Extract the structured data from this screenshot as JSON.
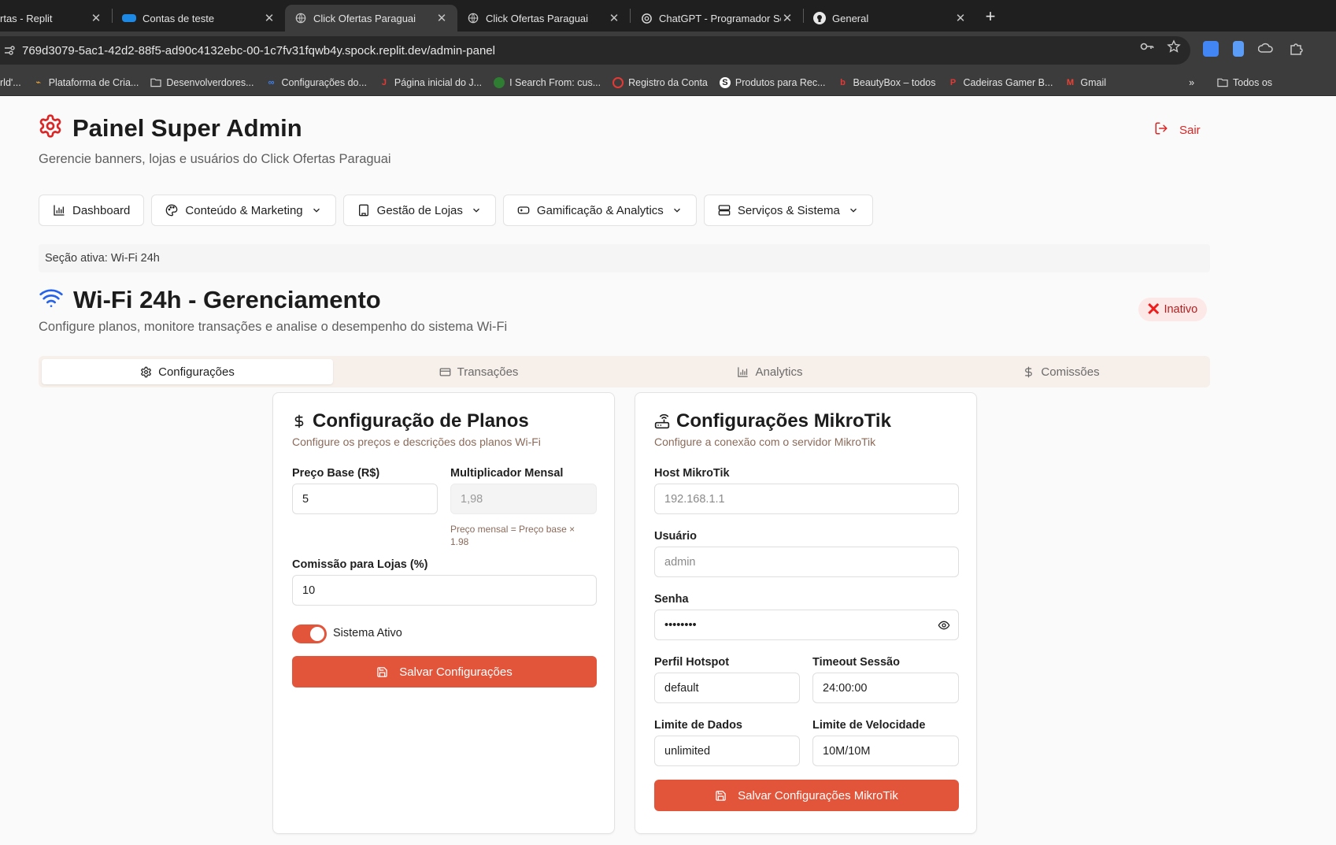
{
  "browser": {
    "tabs": [
      {
        "title": "rtas - Replit",
        "active": false
      },
      {
        "title": "Contas de teste",
        "active": false
      },
      {
        "title": "Click Ofertas Paraguai",
        "active": true
      },
      {
        "title": "Click Ofertas Paraguai",
        "active": false
      },
      {
        "title": "ChatGPT - Programador Seni",
        "active": false
      },
      {
        "title": "General",
        "active": false
      }
    ],
    "url": "769d3079-5ac1-42d2-88f5-ad90c4132ebc-00-1c7fv31fqwb4y.spock.replit.dev/admin-panel",
    "bookmarks": [
      {
        "label": "rld'...",
        "icon": "globe-icon"
      },
      {
        "label": "Plataforma de Cria...",
        "icon": "bookmark-icon"
      },
      {
        "label": "Desenvolverdores...",
        "icon": "folder-icon"
      },
      {
        "label": "Configurações do...",
        "icon": "meta-icon"
      },
      {
        "label": "Página inicial do J...",
        "icon": "bookmark-icon"
      },
      {
        "label": "I Search From: cus...",
        "icon": "globe-icon"
      },
      {
        "label": "Registro da Conta",
        "icon": "circle-icon"
      },
      {
        "label": "Produtos para Rec...",
        "icon": "shopify-icon"
      },
      {
        "label": "BeautyBox – todos",
        "icon": "bookmark-icon"
      },
      {
        "label": "Cadeiras Gamer B...",
        "icon": "bookmark-icon"
      },
      {
        "label": "Gmail",
        "icon": "gmail-icon"
      }
    ],
    "more_bookmarks": "»",
    "all_bookmarks": "Todos os"
  },
  "header": {
    "title": "Painel Super Admin",
    "subtitle": "Gerencie banners, lojas e usuários do Click Ofertas Paraguai",
    "logout_label": "Sair"
  },
  "nav": [
    {
      "label": "Dashboard",
      "icon": "bar-chart-icon",
      "dropdown": false
    },
    {
      "label": "Conteúdo & Marketing",
      "icon": "palette-icon",
      "dropdown": true
    },
    {
      "label": "Gestão de Lojas",
      "icon": "building-icon",
      "dropdown": true
    },
    {
      "label": "Gamificação & Analytics",
      "icon": "gamepad-icon",
      "dropdown": true
    },
    {
      "label": "Serviços & Sistema",
      "icon": "server-icon",
      "dropdown": true
    }
  ],
  "active_section": "Seção ativa: Wi-Fi 24h",
  "wifi": {
    "title": "Wi-Fi 24h - Gerenciamento",
    "subtitle": "Configure planos, monitore transações e analise o desempenho do sistema Wi-Fi",
    "status": "Inativo",
    "status_color": "#fde8e8"
  },
  "tabs": [
    {
      "label": "Configurações",
      "icon": "gear-icon",
      "active": true
    },
    {
      "label": "Transações",
      "icon": "credit-card-icon",
      "active": false
    },
    {
      "label": "Analytics",
      "icon": "bar-chart-icon",
      "active": false
    },
    {
      "label": "Comissões",
      "icon": "dollar-icon",
      "active": false
    }
  ],
  "plans_card": {
    "title": "Configuração de Planos",
    "description": "Configure os preços e descrições dos planos Wi-Fi",
    "base_price_label": "Preço Base (R$)",
    "base_price_value": "5",
    "multiplier_label": "Multiplicador Mensal",
    "multiplier_value": "1,98",
    "multiplier_hint_1": "Preço mensal = Preço base ×",
    "multiplier_hint_2": "1.98",
    "commission_label": "Comissão para Lojas (%)",
    "commission_value": "10",
    "system_active_label": "Sistema Ativo",
    "system_active": true,
    "save_label": "Salvar Configurações"
  },
  "mikrotik_card": {
    "title": "Configurações MikroTik",
    "description": "Configure a conexão com o servidor MikroTik",
    "host_label": "Host MikroTik",
    "host_placeholder": "192.168.1.1",
    "user_label": "Usuário",
    "user_placeholder": "admin",
    "password_label": "Senha",
    "password_value": "••••••••",
    "profile_label": "Perfil Hotspot",
    "profile_value": "default",
    "timeout_label": "Timeout Sessão",
    "timeout_value": "24:00:00",
    "data_limit_label": "Limite de Dados",
    "data_limit_value": "unlimited",
    "speed_limit_label": "Limite de Velocidade",
    "speed_limit_value": "10M/10M",
    "save_label": "Salvar Configurações MikroTik"
  },
  "colors": {
    "accent": "#e2553a",
    "danger": "#dc2626",
    "wifi_icon": "#2563eb"
  }
}
